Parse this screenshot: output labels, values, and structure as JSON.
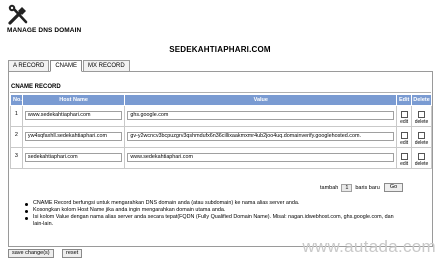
{
  "page": {
    "heading": "MANAGE DNS DOMAIN",
    "domain": "SEDEKAHTIAPHARI.COM"
  },
  "tabs": [
    "A RECORD",
    "CNAME",
    "MX RECORD"
  ],
  "panel": {
    "title": "CNAME RECORD"
  },
  "table": {
    "headers": {
      "no": "No.",
      "host": "Host Name",
      "value": "Value",
      "edit": "Edit",
      "delete": "Delete"
    },
    "rows": [
      {
        "no": "1",
        "host": "www.sedekahtiaphari.com",
        "value": "ghs.google.com",
        "edit": "edit",
        "delete": "delete"
      },
      {
        "no": "2",
        "host": "yw4sqfaxhll.sedekahtiaphari.com",
        "value": "gv-y2wcncv3bcpuzgrv3qshmdufx6n36cillixaakmxmr4ub2joo4uq.domainverify.googlehosted.com.",
        "edit": "edit",
        "delete": "delete"
      },
      {
        "no": "3",
        "host": "sedekahtiaphari.com",
        "value": "www.sedekahtiaphari.com",
        "edit": "edit",
        "delete": "delete"
      }
    ]
  },
  "add_rows": {
    "label_before": "tambah",
    "count": "1",
    "label_after": "baris baru",
    "go": "Go"
  },
  "notes": [
    "CNAME Record berfungsi untuk mengarahkan DNS domain anda (atau subdomain) ke nama alias server anda.",
    "Kosongkan kolom Host Name jika anda ingin mengarahkan domain utama anda.",
    "Isi kolom Value dengan nama alias server anda secara tepat(FQDN (Fully Qualified Domain Name). Misal: nagan.idwebhost.com, ghs.google.com, dan lain-lain."
  ],
  "buttons": {
    "save": "save change(s)",
    "reset": "reset"
  },
  "watermark": "www.autada.com",
  "icons": {
    "tools": "tools-icon"
  },
  "colors": {
    "table_header": "#7a9bd2",
    "watermark": "#c9c9c9"
  }
}
